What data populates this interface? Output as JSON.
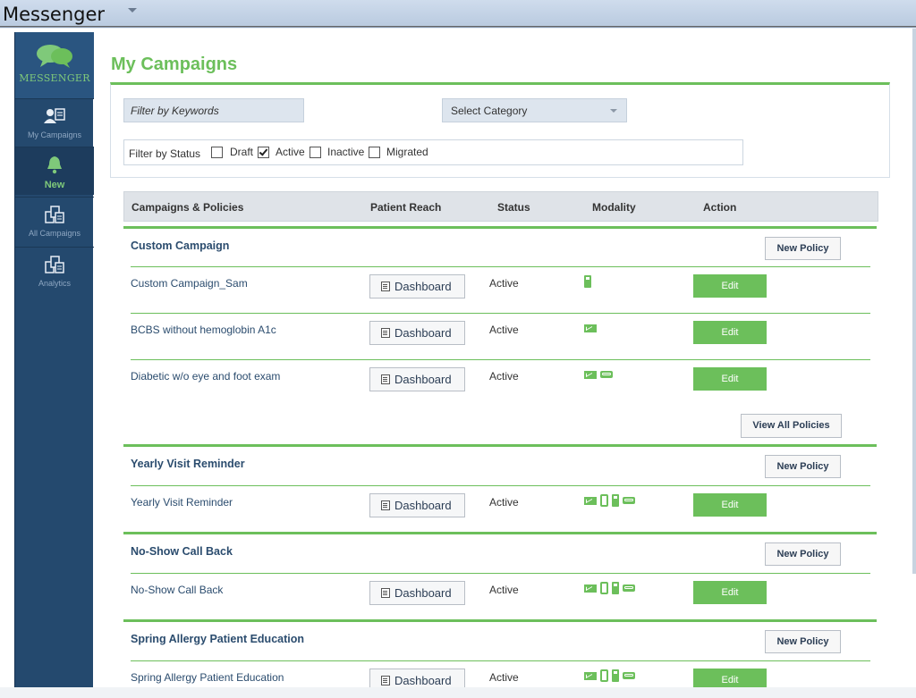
{
  "window": {
    "title": "Messenger"
  },
  "sidebar": {
    "logo_text": "MESSENGER",
    "items": [
      {
        "label": "My Campaigns",
        "icon": "user-list-icon"
      },
      {
        "label": "New",
        "icon": "bell-icon"
      },
      {
        "label": "All Campaigns",
        "icon": "stacked-files-icon"
      },
      {
        "label": "Analytics",
        "icon": "stacked-files-icon"
      }
    ]
  },
  "page": {
    "title": "My Campaigns"
  },
  "filters": {
    "keyword_placeholder": "Filter by Keywords",
    "category_value": "Select Category",
    "status_label": "Filter by Status",
    "statuses": [
      {
        "label": "Draft",
        "checked": false
      },
      {
        "label": "Active",
        "checked": true
      },
      {
        "label": "Inactive",
        "checked": false
      },
      {
        "label": "Migrated",
        "checked": false
      }
    ]
  },
  "table": {
    "headers": [
      "Campaigns & Policies",
      "Patient Reach",
      "Status",
      "Modality",
      "Action"
    ],
    "dashboard_label": "Dashboard",
    "edit_label": "Edit",
    "new_policy_label": "New Policy",
    "view_all_label": "View All Policies",
    "groups": [
      {
        "name": "Custom Campaign",
        "rows": [
          {
            "name": "Custom Campaign_Sam",
            "status": "Active",
            "modalities": [
              "phone"
            ]
          },
          {
            "name": "BCBS without hemoglobin A1c",
            "status": "Active",
            "modalities": [
              "email"
            ]
          },
          {
            "name": "Diabetic w/o eye and foot exam",
            "status": "Active",
            "modalities": [
              "email",
              "voicemail"
            ]
          }
        ]
      },
      {
        "name": "Yearly Visit Reminder",
        "rows": [
          {
            "name": "Yearly Visit Reminder",
            "status": "Active",
            "modalities": [
              "email",
              "mobile",
              "phone",
              "voicemail"
            ]
          }
        ]
      },
      {
        "name": "No-Show Call Back",
        "rows": [
          {
            "name": "No-Show Call Back",
            "status": "Active",
            "modalities": [
              "email",
              "mobile",
              "phone",
              "voicemail"
            ]
          }
        ]
      },
      {
        "name": "Spring Allergy Patient Education",
        "rows": [
          {
            "name": "Spring Allergy Patient Education",
            "status": "Active",
            "modalities": [
              "email",
              "mobile",
              "phone",
              "voicemail"
            ]
          }
        ]
      }
    ]
  },
  "colors": {
    "accent": "#6cbf5b",
    "sidebar": "#24496e",
    "heading": "#2b4c6e"
  }
}
